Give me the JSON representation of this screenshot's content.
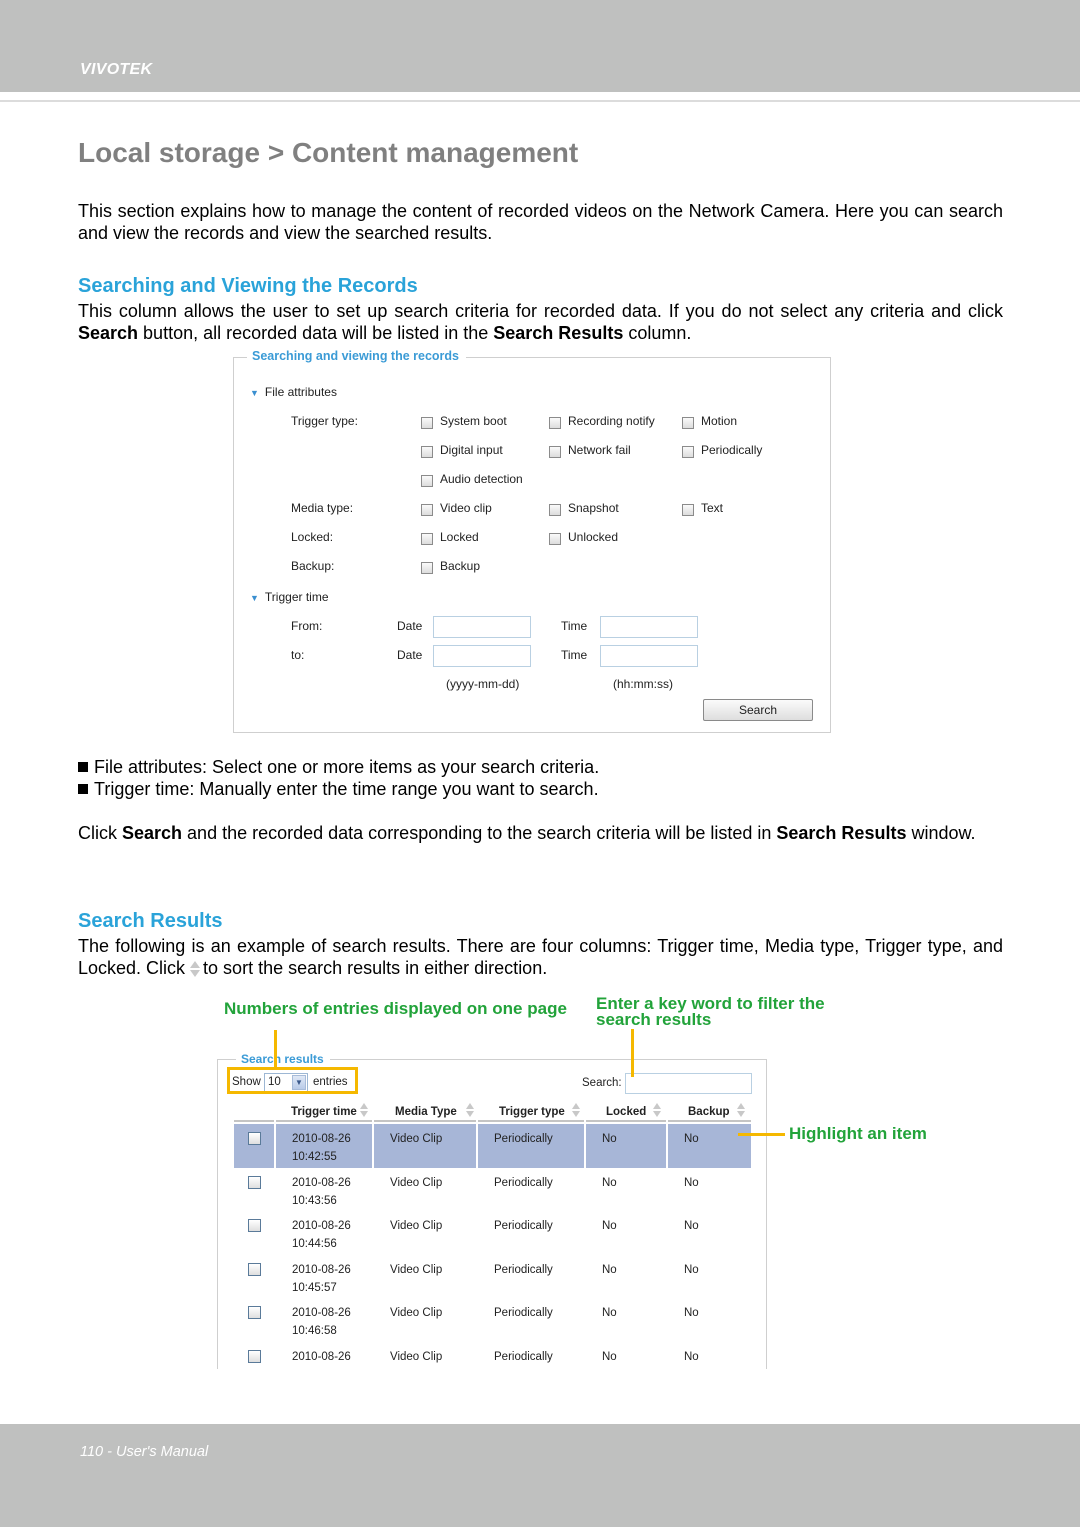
{
  "header": {
    "brand": "VIVOTEK"
  },
  "page_title": "Local storage > Content management",
  "intro": "This section explains how to manage the content of recorded videos on the Network Camera. Here you can search and view the records and view the searched results.",
  "section1": {
    "heading": "Searching and Viewing the Records",
    "text_parts": [
      "This column allows the user to set up search criteria for recorded data. If you do not select any criteria and click ",
      "Search",
      " button, all recorded data will be listed in the ",
      "Search Results",
      " column."
    ]
  },
  "search_form": {
    "legend": "Searching and viewing the records",
    "file_attributes_label": "File attributes",
    "trigger_type_label": "Trigger type:",
    "trigger_types": [
      "System boot",
      "Recording notify",
      "Motion",
      "Digital input",
      "Network fail",
      "Periodically",
      "Audio detection"
    ],
    "media_type_label": "Media type:",
    "media_types": [
      "Video clip",
      "Snapshot",
      "Text"
    ],
    "locked_label": "Locked:",
    "locked_options": [
      "Locked",
      "Unlocked"
    ],
    "backup_label": "Backup:",
    "backup_options": [
      "Backup"
    ],
    "trigger_time_label": "Trigger time",
    "from_label": "From:",
    "to_label": "to:",
    "date_label": "Date",
    "time_label": "Time",
    "from_date": "",
    "from_time": "",
    "to_date": "",
    "to_time": "",
    "date_hint": "(yyyy-mm-dd)",
    "time_hint": "(hh:mm:ss)",
    "search_button": "Search"
  },
  "bullets": [
    "File attributes: Select one or more items as your search criteria.",
    "Trigger time: Manually enter the time range you want to search."
  ],
  "click_text_parts": [
    "Click ",
    "Search",
    " and the recorded data corresponding to the search criteria will be listed in ",
    "Search Results",
    " window."
  ],
  "section2": {
    "heading": "Search Results",
    "text_a": "The following is an example of search results. There are four columns: Trigger time, Media type, Trigger type, and Locked. Click",
    "text_b": "to sort the search results in either direction."
  },
  "annotations": {
    "entries": "Numbers of entries displayed on one page",
    "keyword": "Enter a key word to filter the search results",
    "highlight": "Highlight an item",
    "accent_color": "#f5b800",
    "text_color": "#22a33a"
  },
  "results_panel": {
    "legend": "Search results",
    "show_label": "Show",
    "entries_value": "10",
    "entries_label": "entries",
    "search_label": "Search:",
    "search_value": "",
    "columns": [
      "Trigger time",
      "Media Type",
      "Trigger type",
      "Locked",
      "Backup"
    ],
    "highlight_color": "#a7b6d7",
    "rows": [
      {
        "date": "2010-08-26",
        "time": "10:42:55",
        "media": "Video Clip",
        "trigger": "Periodically",
        "locked": "No",
        "backup": "No",
        "highlighted": true
      },
      {
        "date": "2010-08-26",
        "time": "10:43:56",
        "media": "Video Clip",
        "trigger": "Periodically",
        "locked": "No",
        "backup": "No",
        "highlighted": false
      },
      {
        "date": "2010-08-26",
        "time": "10:44:56",
        "media": "Video Clip",
        "trigger": "Periodically",
        "locked": "No",
        "backup": "No",
        "highlighted": false
      },
      {
        "date": "2010-08-26",
        "time": "10:45:57",
        "media": "Video Clip",
        "trigger": "Periodically",
        "locked": "No",
        "backup": "No",
        "highlighted": false
      },
      {
        "date": "2010-08-26",
        "time": "10:46:58",
        "media": "Video Clip",
        "trigger": "Periodically",
        "locked": "No",
        "backup": "No",
        "highlighted": false
      },
      {
        "date": "2010-08-26",
        "time": "",
        "media": "Video Clip",
        "trigger": "Periodically",
        "locked": "No",
        "backup": "No",
        "highlighted": false
      }
    ]
  },
  "footer": {
    "text": "110 - User's Manual"
  }
}
